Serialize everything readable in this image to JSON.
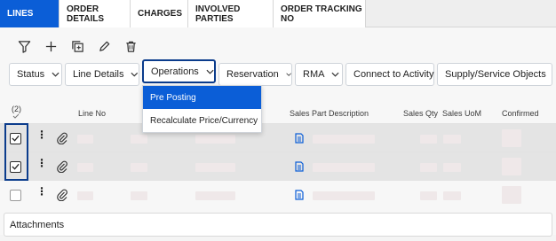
{
  "tabs": [
    {
      "label": "LINES",
      "active": true
    },
    {
      "label": "ORDER DETAILS",
      "active": false
    },
    {
      "label": "CHARGES",
      "active": false
    },
    {
      "label": "INVOLVED PARTIES",
      "active": false
    },
    {
      "label": "ORDER TRACKING NO",
      "active": false
    }
  ],
  "toolbar": {
    "icons": [
      "filter-icon",
      "add-icon",
      "duplicate-icon",
      "edit-icon",
      "delete-icon"
    ]
  },
  "filters": [
    {
      "label": "Status",
      "has_chevron": true
    },
    {
      "label": "Line Details",
      "has_chevron": true
    },
    {
      "label": "Operations",
      "has_chevron": true,
      "open": true
    },
    {
      "label": "Reservation",
      "has_chevron": true
    },
    {
      "label": "RMA",
      "has_chevron": true
    },
    {
      "label": "Connect to Activity",
      "has_chevron": false
    },
    {
      "label": "Supply/Service Objects",
      "has_chevron": true
    }
  ],
  "operations_menu": {
    "items": [
      {
        "label": "Pre Posting",
        "highlighted": true
      },
      {
        "label": "Recalculate Price/Currency",
        "highlighted": false
      }
    ]
  },
  "grid": {
    "selected_count": "(2)",
    "columns": [
      "Line No",
      "Sales Part Description",
      "Sales Qty",
      "Sales UoM",
      "Confirmed"
    ],
    "rows": [
      {
        "checked": true
      },
      {
        "checked": true
      },
      {
        "checked": false
      }
    ]
  },
  "attachments": {
    "label": "Attachments"
  },
  "colors": {
    "accent": "#0b5ed7",
    "focus": "#0b3c8c",
    "selected_row": "#e4e4e4"
  }
}
